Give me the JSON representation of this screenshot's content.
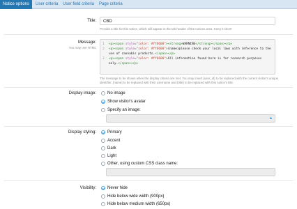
{
  "tabs": [
    {
      "label": "Notice options"
    },
    {
      "label": "User criteria"
    },
    {
      "label": "User field criteria"
    },
    {
      "label": "Page criteria"
    }
  ],
  "title_field": {
    "label": "Title:",
    "value": "CBD",
    "help": "Provide a title for this notice, which will appear in the tab header of the notices area. Keep it short!"
  },
  "message": {
    "label": "Message:",
    "sublabel": "You may use HTML",
    "lines": [
      {
        "num": "1",
        "parts": [
          {
            "c": "tag",
            "t": "<p>"
          },
          {
            "c": "tag",
            "t": "<span "
          },
          {
            "c": "attr",
            "t": "style"
          },
          {
            "c": "tag",
            "t": "="
          },
          {
            "c": "str",
            "t": "\"color: #ff6600\""
          },
          {
            "c": "tag",
            "t": ">"
          },
          {
            "c": "tag",
            "t": "<strong>"
          },
          {
            "c": "txt",
            "t": "WARNING"
          },
          {
            "c": "tag",
            "t": "</strong></span></p>"
          }
        ]
      },
      {
        "num": "2",
        "parts": [
          {
            "c": "tag",
            "t": "<p>"
          },
          {
            "c": "tag",
            "t": "<span "
          },
          {
            "c": "attr",
            "t": "style"
          },
          {
            "c": "tag",
            "t": "="
          },
          {
            "c": "str",
            "t": "\"color: #ff6600\""
          },
          {
            "c": "tag",
            "t": ">"
          },
          {
            "c": "txt",
            "t": "{name}please check your local laws with reference to the use of cannabis products."
          },
          {
            "c": "tag",
            "t": "</span></p>"
          }
        ]
      },
      {
        "num": "3",
        "parts": [
          {
            "c": "tag",
            "t": "<p>"
          },
          {
            "c": "tag",
            "t": "<span "
          },
          {
            "c": "attr",
            "t": "style"
          },
          {
            "c": "tag",
            "t": "="
          },
          {
            "c": "str",
            "t": "\"color: #ff6600\""
          },
          {
            "c": "tag",
            "t": ">"
          },
          {
            "c": "txt",
            "t": "All information found here is for research purposes only."
          },
          {
            "c": "tag",
            "t": "</span></p>"
          }
        ]
      }
    ],
    "help": "The message to be shown when the display criteria are met. You may insert {user_id} to be replaced with the current visitor's unique identifier, {name} to be replaced with their username and {title} to be replaced with this notice's title."
  },
  "display_image": {
    "label": "Display image:",
    "options": [
      {
        "label": "No image",
        "checked": false
      },
      {
        "label": "Show visitor's avatar",
        "checked": true
      },
      {
        "label": "Specify an image:",
        "checked": false
      }
    ],
    "upload_icon": "upload-icon"
  },
  "display_styling": {
    "label": "Display styling:",
    "options": [
      {
        "label": "Primary",
        "checked": true
      },
      {
        "label": "Accent",
        "checked": false
      },
      {
        "label": "Dark",
        "checked": false
      },
      {
        "label": "Light",
        "checked": false
      },
      {
        "label": "Other, using custom CSS class name:",
        "checked": false
      }
    ]
  },
  "visibility": {
    "label": "Visibility:",
    "options": [
      {
        "label": "Never hide",
        "checked": true
      },
      {
        "label": "Hide below wide width (900px)",
        "checked": false
      },
      {
        "label": "Hide below medium width (650px)",
        "checked": false
      }
    ]
  },
  "colors": {
    "accent": "#2577b1",
    "tab_bar": "#d8e5f3",
    "checked": "#47a7eb"
  }
}
